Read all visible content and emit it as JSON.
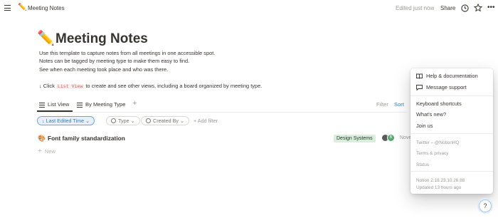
{
  "topbar": {
    "page_emoji": "✏️",
    "page_title": "Meeting Notes",
    "edited": "Edited just now",
    "share_label": "Share",
    "more_label": "•••"
  },
  "page": {
    "emoji": "✏️",
    "title": "Meeting Notes",
    "desc1": "Use this template to capture notes from all meetings in one accessible spot.",
    "desc2": "Notes can be tagged by meeting type to make them easy to find.",
    "desc3": "See when each meeting took place and who was there.",
    "desc4_pre": "↓ Click ",
    "desc4_code": "List View",
    "desc4_post": " to create and see other views, including a board organized by meeting type."
  },
  "views": {
    "tabs": [
      {
        "label": "List View"
      },
      {
        "label": "By Meeting Type"
      }
    ],
    "add_label": "+",
    "filter_label": "Filter",
    "sort_label": "Sort"
  },
  "filters": {
    "sort_chip": "↓ Last Edited Time ⌄",
    "type_chip": "Type ⌄",
    "created_chip": "Created By ⌄",
    "add_filter": "+ Add filter"
  },
  "rows": [
    {
      "emoji": "🎨",
      "title": "Font family standardization",
      "tag": "Design Systems",
      "avatar2_initial": "B",
      "date": "Nove"
    }
  ],
  "new_row_label": "New",
  "help_menu": {
    "help_docs": "Help & documentation",
    "message_support": "Message support",
    "keyboard_shortcuts": "Keyboard shortcuts",
    "whats_new": "What's new?",
    "join_us": "Join us",
    "twitter": "Twitter – @NotionHQ",
    "terms": "Terms & privacy",
    "status": "Status",
    "version": "Notion 2.18.23.10.26.88",
    "updated": "Updated 13 hours ago"
  },
  "help_button_label": "?",
  "colors": {
    "accent_blue": "#2e7dc9",
    "tag_green_bg": "#dbeddb",
    "code_red": "#eb5757"
  }
}
